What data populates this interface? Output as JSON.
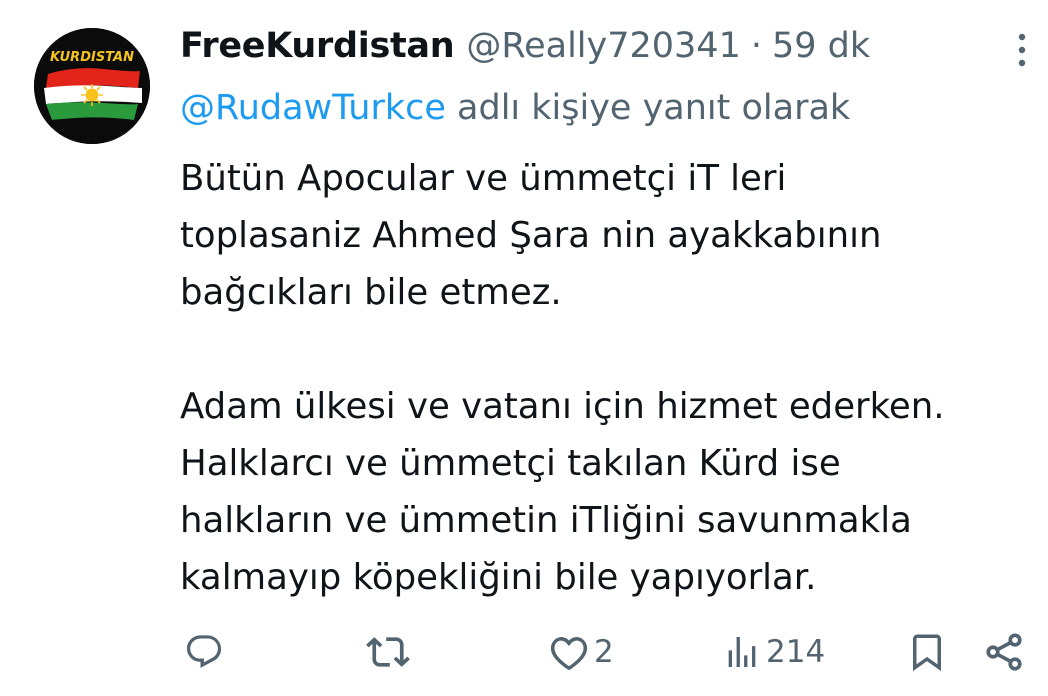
{
  "tweet": {
    "avatar": {
      "text": "KURDISTAN",
      "colors": {
        "red": "#e2241b",
        "white": "#ffffff",
        "green": "#2b9a3d",
        "sun": "#f7c21b",
        "text": "#f3c321"
      }
    },
    "display_name": "FreeKurdistan",
    "handle": "@Really720341",
    "separator": "·",
    "time": "59 dk",
    "reply_to": {
      "handle": "@RudawTurkce",
      "suffix": " adlı kişiye yanıt olarak"
    },
    "body": {
      "line1": "Bütün Apocular ve ümmetçi iT leri",
      "line2": "toplasaniz Ahmed Şara nin ayakkabının",
      "line3": "bağcıkları bile etmez.",
      "line4": "Adam ülkesi ve vatanı için hizmet ederken.",
      "line5": "Halklarcı ve ümmetçi takılan Kürd ise",
      "line6": "halkların ve ümmetin iTliğini savunmakla",
      "line7": "kalmayıp köpekliğini bile yapıyorlar."
    },
    "actions": {
      "reply_icon": "reply-icon",
      "retweet_icon": "retweet-icon",
      "like_icon": "heart-icon",
      "like_count": "2",
      "views_icon": "bar-chart-icon",
      "views_count": "214",
      "bookmark_icon": "bookmark-icon",
      "share_icon": "share-icon"
    },
    "more_icon": "vertical-dots-icon",
    "colors": {
      "text": "#0f1419",
      "secondary": "#536471",
      "link": "#1d9bf0",
      "background": "#ffffff"
    }
  }
}
